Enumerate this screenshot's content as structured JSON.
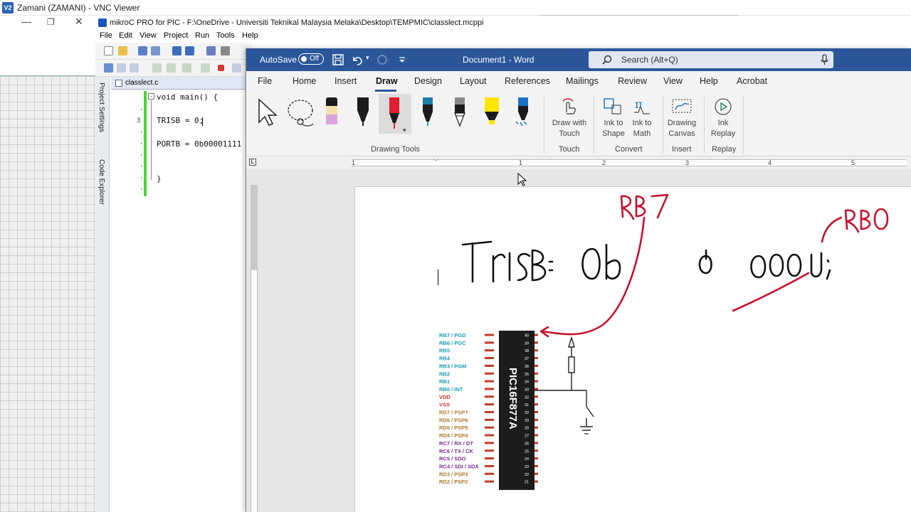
{
  "vnc": {
    "title": "Zamani (ZAMANI) - VNC Viewer",
    "logo": "V2"
  },
  "mikroc": {
    "title": "mikroC PRO for PIC - F:\\OneDrive - Universiti Teknikal Malaysia Melaka\\Desktop\\TEMPMIC\\classlect.mcppi",
    "menu": [
      "File",
      "Edit",
      "View",
      "Project",
      "Run",
      "Tools",
      "Help"
    ],
    "side_tabs": [
      "Project Settings",
      "Code Explorer"
    ],
    "editor_tab": "classlect.c",
    "line_numbers": [
      "3"
    ],
    "code": [
      "void main() {",
      "TRISB = 0;",
      "PORTB = 0b00001111",
      "}"
    ]
  },
  "word": {
    "autosave_label": "AutoSave",
    "autosave_state": "Off",
    "doc_title": "Document1 - Word",
    "search_placeholder": "Search (Alt+Q)",
    "tabs": [
      "File",
      "Home",
      "Insert",
      "Draw",
      "Design",
      "Layout",
      "References",
      "Mailings",
      "Review",
      "View",
      "Help",
      "Acrobat"
    ],
    "active_tab": "Draw",
    "groups": {
      "drawing_tools": "Drawing Tools",
      "touch": "Touch",
      "convert": "Convert",
      "insert": "Insert",
      "replay": "Replay"
    },
    "buttons": {
      "draw_with_touch": [
        "Draw with",
        "Touch"
      ],
      "ink_to_shape": [
        "Ink to",
        "Shape"
      ],
      "ink_to_math": [
        "Ink to",
        "Math"
      ],
      "drawing_canvas": [
        "Drawing",
        "Canvas"
      ],
      "ink_replay": [
        "Ink",
        "Replay"
      ]
    },
    "ruler_numbers": [
      "1",
      "1",
      "2",
      "3",
      "4",
      "5"
    ],
    "ink": {
      "handwritten": "TRISB= 0b 0 0000;",
      "annotation_rb7": "RB7",
      "annotation_rb0": "RB0"
    },
    "chip": {
      "name": "PIC16F877A",
      "left_pins": [
        {
          "label": "RB7 / PGD",
          "color": "#1a9bb3",
          "num": "40"
        },
        {
          "label": "RB6 / PGC",
          "color": "#1a9bb3",
          "num": "39"
        },
        {
          "label": "RB5",
          "color": "#1a9bb3",
          "num": "38"
        },
        {
          "label": "RB4",
          "color": "#1a9bb3",
          "num": "37"
        },
        {
          "label": "RB3 / PGM",
          "color": "#1a9bb3",
          "num": "36"
        },
        {
          "label": "RB2",
          "color": "#1a9bb3",
          "num": "35"
        },
        {
          "label": "RB1",
          "color": "#1a9bb3",
          "num": "34"
        },
        {
          "label": "RB0 / INT",
          "color": "#1a9bb3",
          "num": "33"
        },
        {
          "label": "VDD",
          "color": "#c0392b",
          "num": "32"
        },
        {
          "label": "VSS",
          "color": "#c0392b",
          "num": "31"
        },
        {
          "label": "RD7 / PSP7",
          "color": "#a67c2e",
          "num": "30"
        },
        {
          "label": "RD6 / PSP6",
          "color": "#a67c2e",
          "num": "29"
        },
        {
          "label": "RD5 / PSP5",
          "color": "#a67c2e",
          "num": "28"
        },
        {
          "label": "RD4 / PSP4",
          "color": "#a67c2e",
          "num": "27"
        },
        {
          "label": "RC7 / RX / DT",
          "color": "#7b2d8e",
          "num": "26"
        },
        {
          "label": "RC6 / TX / CK",
          "color": "#7b2d8e",
          "num": "25"
        },
        {
          "label": "RC5 / SDO",
          "color": "#7b2d8e",
          "num": "24"
        },
        {
          "label": "RC4 / SDI / SDA",
          "color": "#7b2d8e",
          "num": "23"
        },
        {
          "label": "RD3 / PSP3",
          "color": "#a67c2e",
          "num": "22"
        },
        {
          "label": "RD2 / PSP2",
          "color": "#a67c2e",
          "num": "21"
        }
      ]
    }
  }
}
